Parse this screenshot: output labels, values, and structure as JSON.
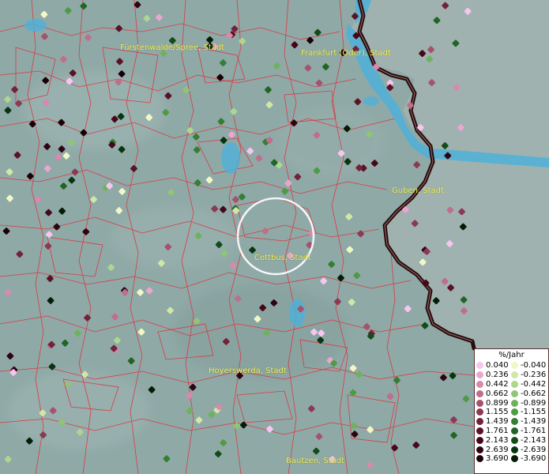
{
  "map": {
    "water_color": "#4fb0d8",
    "land_color": "#8fa9a7",
    "neighbor_land_color": "#9fb2b0",
    "boundary_color": "#e0303a",
    "border_color": "#2a0a0a"
  },
  "cities": [
    {
      "name": "Fürstenwalde/Spree, Stadt"
    },
    {
      "name": "Frankfurt (Oder), Stadt"
    },
    {
      "name": "Guben, Stadt"
    },
    {
      "name": "Cottbus, Stadt"
    },
    {
      "name": "Hoyerswerda, Stadt"
    },
    {
      "name": "Bautzen, Stadt"
    }
  ],
  "legend": {
    "title": "%/Jahr",
    "positive": [
      {
        "value": "0.040",
        "color": "#f7c6ee"
      },
      {
        "value": "0.236",
        "color": "#e9a6cf"
      },
      {
        "value": "0.442",
        "color": "#d889ad"
      },
      {
        "value": "0.662",
        "color": "#c06e8b"
      },
      {
        "value": "0.899",
        "color": "#a5536c"
      },
      {
        "value": "1.155",
        "color": "#8c3a52"
      },
      {
        "value": "1.439",
        "color": "#74223a"
      },
      {
        "value": "1.761",
        "color": "#5c1226"
      },
      {
        "value": "2.143",
        "color": "#460818"
      },
      {
        "value": "2.639",
        "color": "#300310"
      },
      {
        "value": "3.690",
        "color": "#1a0006"
      }
    ],
    "negative": [
      {
        "value": "-0.040",
        "color": "#f2f7c6"
      },
      {
        "value": "-0.236",
        "color": "#cfe8a6"
      },
      {
        "value": "-0.442",
        "color": "#aed68d"
      },
      {
        "value": "-0.662",
        "color": "#8fc575"
      },
      {
        "value": "-0.899",
        "color": "#6fb25d"
      },
      {
        "value": "-1.155",
        "color": "#4f9a46"
      },
      {
        "value": "-1.439",
        "color": "#357f33"
      },
      {
        "value": "-1.761",
        "color": "#216526"
      },
      {
        "value": "-2.143",
        "color": "#124c19"
      },
      {
        "value": "-2.639",
        "color": "#08350f"
      },
      {
        "value": "-3.690",
        "color": "#021c05"
      }
    ]
  }
}
